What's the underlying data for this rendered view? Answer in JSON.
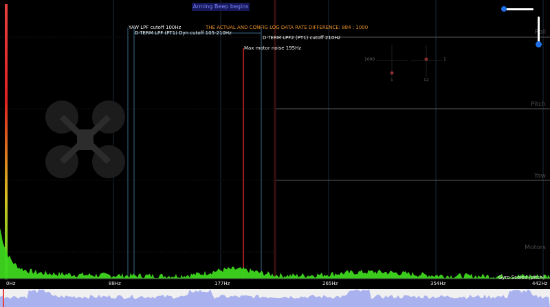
{
  "banner": {
    "text": "Arming Beep begins"
  },
  "warning": {
    "text": "THE ACTUAL AND CONFIG LOG DATA RATE DIFFERENCE: 884 : 1000"
  },
  "markers": {
    "yaw_lpf": "YAW LPF cutoff 100Hz",
    "dterm_lpf": "D-TERM LPF (PT1) Dyn cutoff 105-210Hz",
    "dterm_lpf2": "D-TERM LPF2 (PT1) cutoff 210Hz",
    "motor_noise": "Max motor noise 195Hz"
  },
  "plot_labels": {
    "roll": "Roll",
    "pitch": "Pitch",
    "yaw": "Yaw",
    "motors": "Motors"
  },
  "stick_overlay": {
    "left_value": "1000",
    "right_value": "1",
    "bottom_left": "1",
    "bottom_right": "12"
  },
  "axis": {
    "ticks": [
      "0Hz",
      "88Hz",
      "177Hz",
      "265Hz",
      "354Hz",
      "442Hz"
    ]
  },
  "series_label": "Gyro Scaled [pitch]",
  "colors": {
    "spectrum": "#3ed61e",
    "cutoff_line": "#3a6a8a",
    "motor_line": "#d02a2a",
    "seek_wave": "#a9b2ee",
    "left_bar": "#e84040"
  },
  "controls": {
    "zoom_slider_h": 0.05,
    "zoom_slider_v": 0.9
  }
}
